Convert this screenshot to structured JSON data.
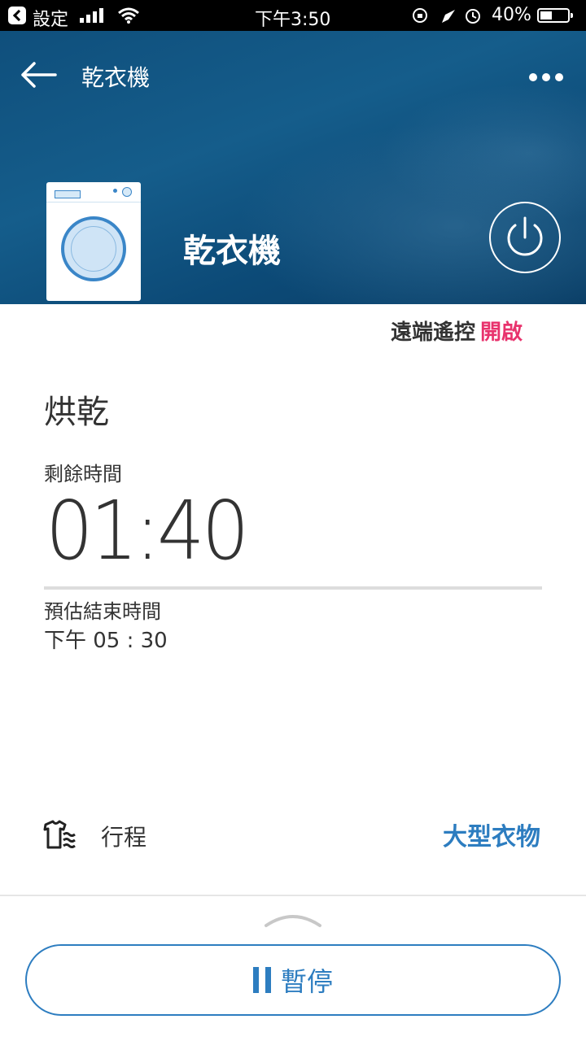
{
  "status_bar": {
    "carrier": "設定",
    "time": "下午3:50",
    "battery": "40%"
  },
  "header": {
    "title": "乾衣機",
    "device_name": "乾衣機"
  },
  "remote_control": {
    "label": "遠端遙控",
    "status": "開啟",
    "status_color": "#e8336d"
  },
  "cycle": {
    "mode": "烘乾",
    "remaining_label": "剩餘時間",
    "remaining_time": "01:40",
    "end_label": "預估結束時間",
    "end_time": "下午 05 : 30"
  },
  "program": {
    "label": "行程",
    "value": "大型衣物"
  },
  "actions": {
    "pause_label": "暫停"
  },
  "colors": {
    "accent": "#2d7dc0",
    "header_bg": "#0f4f7c"
  }
}
